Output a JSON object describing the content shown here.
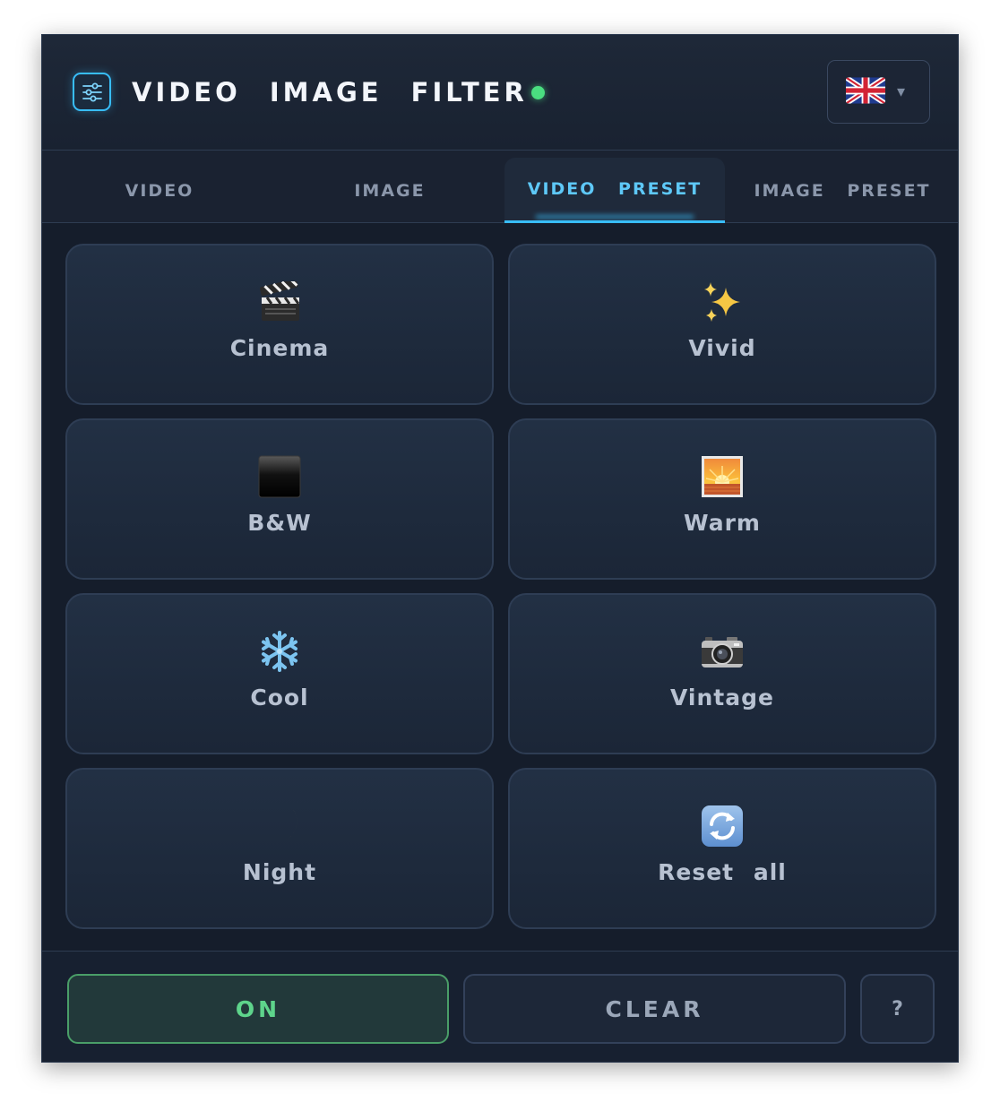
{
  "app": {
    "title": "VIDEO IMAGE FILTER",
    "status": "active",
    "language": "en-GB",
    "accent_color": "#38bdf8",
    "status_color": "#4ade80"
  },
  "header": {
    "logo_icon": "sliders-icon",
    "flag_icon": "uk-flag-icon",
    "dropdown_icon": "caret-down-icon",
    "dropdown_glyph": "▾"
  },
  "tabs": [
    {
      "label": "VIDEO",
      "active": false
    },
    {
      "label": "IMAGE",
      "active": false
    },
    {
      "label": "VIDEO PRESET",
      "active": true
    },
    {
      "label": "IMAGE PRESET",
      "active": false
    }
  ],
  "presets": [
    {
      "label": "Cinema",
      "icon": "clapperboard-icon"
    },
    {
      "label": "Vivid",
      "icon": "sparkles-icon"
    },
    {
      "label": "B&W",
      "icon": "black-square-icon"
    },
    {
      "label": "Warm",
      "icon": "sunset-icon"
    },
    {
      "label": "Cool",
      "icon": "snowflake-icon"
    },
    {
      "label": "Vintage",
      "icon": "camera-icon"
    },
    {
      "label": "Night",
      "icon": "crescent-moon-icon"
    },
    {
      "label": "Reset all",
      "icon": "refresh-icon"
    }
  ],
  "footer": {
    "on_label": "ON",
    "clear_label": "CLEAR",
    "help_label": "?",
    "on_color": "#5ed48b"
  }
}
